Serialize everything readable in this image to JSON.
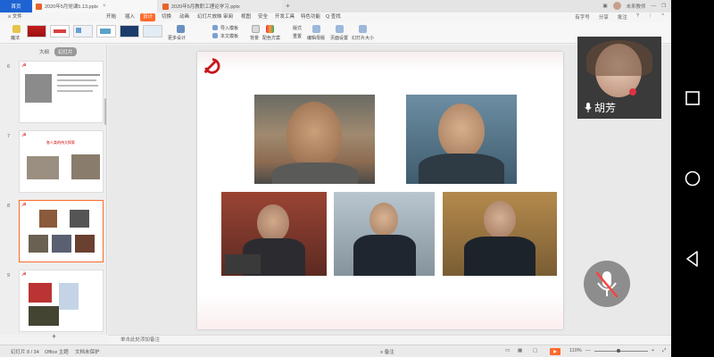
{
  "tabs": {
    "home": "首页",
    "brand": "稻壳模板",
    "doc1": "2020年5月党课5.13.pptx",
    "doc2": "2020年5月教职工理论学习.pptx",
    "user": "未来教师"
  },
  "menu": {
    "file": "≡ 文件",
    "items": [
      "开始",
      "插入",
      "设计",
      "切换",
      "动画",
      "幻灯片放映",
      "审阅",
      "视图",
      "安全",
      "开发工具",
      "特色功能",
      "Q 查找"
    ],
    "active_index": 2,
    "right": [
      "有字号",
      "分享",
      "批注",
      "?"
    ]
  },
  "ribbon": {
    "smart_label": "魔法",
    "more_design": "更多设计",
    "import_template": "导入模板",
    "this_template": "本文模板",
    "background": "背景",
    "color_scheme": "配色方案",
    "format": "版式",
    "reset": "重置",
    "edit_master": "编辑母版",
    "page_setup": "页面设置",
    "slide_size": "幻灯片大小"
  },
  "outline": {
    "tab_outline": "大纲",
    "tab_slides": "幻灯片",
    "slides": [
      {
        "num": "6",
        "title": ""
      },
      {
        "num": "7",
        "title": "各人类的伟大探索"
      },
      {
        "num": "8",
        "title": ""
      },
      {
        "num": "9",
        "title": ""
      }
    ],
    "add": "+"
  },
  "notes": {
    "placeholder": "单击此处添加备注"
  },
  "status": {
    "slide_pos": "幻灯片 8 / 34",
    "theme": "Office 主题",
    "protect": "文档未保护",
    "notes_toggle": "≡ 备注",
    "zoom": "110%",
    "fit": "—",
    "plus": "+"
  },
  "video": {
    "name": "胡芳"
  },
  "colors": {
    "accent": "#ff6a2b",
    "tab_blue": "#1f63d3",
    "party_red": "#c8161d"
  }
}
